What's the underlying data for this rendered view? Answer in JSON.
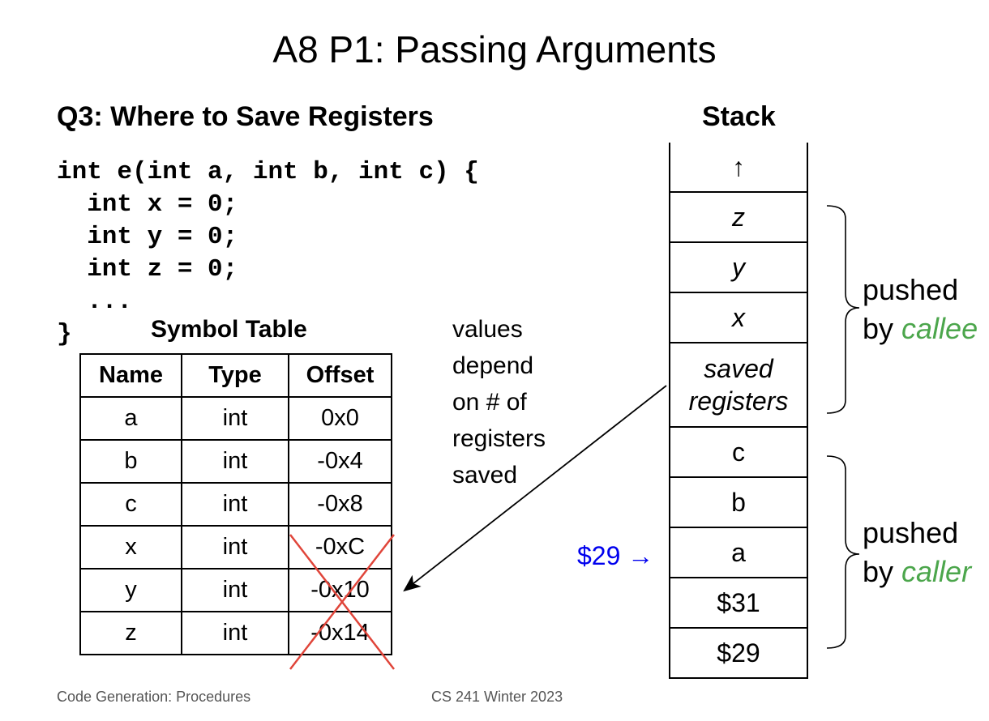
{
  "title": "A8 P1: Passing Arguments",
  "subtitle": "Q3: Where to Save Registers",
  "code_lines": [
    "int e(int a, int b, int c) {",
    "  int x = 0;",
    "  int y = 0;",
    "  int z = 0;",
    "  ...",
    "}"
  ],
  "symbol_table": {
    "title": "Symbol Table",
    "headers": [
      "Name",
      "Type",
      "Offset"
    ],
    "rows": [
      [
        "a",
        "int",
        "0x0"
      ],
      [
        "b",
        "int",
        "-0x4"
      ],
      [
        "c",
        "int",
        "-0x8"
      ],
      [
        "x",
        "int",
        "-0xC"
      ],
      [
        "y",
        "int",
        "-0x10"
      ],
      [
        "z",
        "int",
        "-0x14"
      ]
    ],
    "crossed_out_rows": [
      "x",
      "y",
      "z"
    ]
  },
  "note": [
    "values",
    "depend",
    "on # of",
    "registers",
    "saved"
  ],
  "stack": {
    "label": "Stack",
    "cells": [
      {
        "text": "↑",
        "italic": false
      },
      {
        "text": "z",
        "italic": true
      },
      {
        "text": "y",
        "italic": true
      },
      {
        "text": "x",
        "italic": true
      },
      {
        "text": "saved registers",
        "italic": true
      },
      {
        "text": "c",
        "italic": false
      },
      {
        "text": "b",
        "italic": false
      },
      {
        "text": "a",
        "italic": false
      },
      {
        "text": "$31",
        "italic": false
      },
      {
        "text": "$29",
        "italic": false
      }
    ],
    "pointer": "$29 →"
  },
  "brace_labels": {
    "callee": {
      "prefix": "pushed",
      "by": "by ",
      "who": "callee"
    },
    "caller": {
      "prefix": "pushed",
      "by": "by ",
      "who": "caller"
    }
  },
  "colors": {
    "pointer": "#0000ee",
    "highlight": "#4ca64c",
    "cross": "#e0453a"
  },
  "footer": {
    "left": "Code Generation: Procedures",
    "center": "CS 241 Winter 2023"
  }
}
